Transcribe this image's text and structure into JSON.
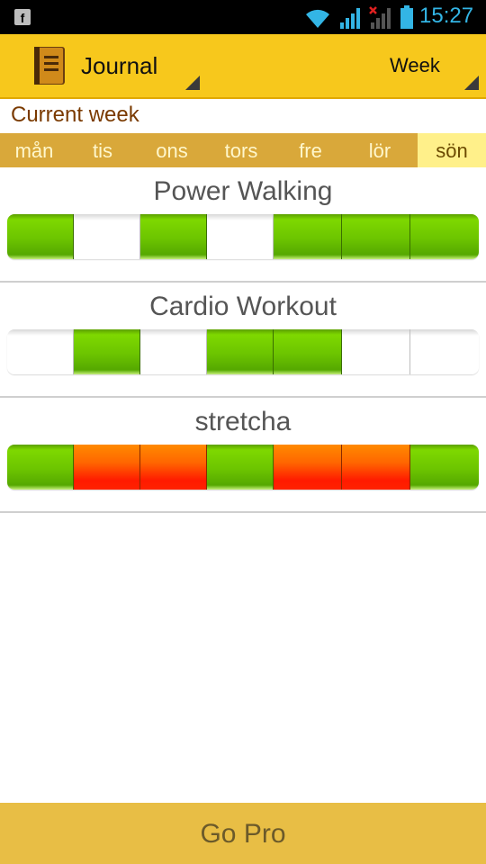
{
  "status_bar": {
    "time": "15:27",
    "notification_icon": "facebook-icon",
    "icons": [
      "wifi-icon",
      "signal-icon",
      "signal-no-sim-icon",
      "battery-icon"
    ],
    "accent_color": "#33b5e5"
  },
  "action_bar": {
    "title": "Journal",
    "period": "Week",
    "background_color": "#f7c81c"
  },
  "section_title": "Current week",
  "days": [
    {
      "label": "mån",
      "selected": false
    },
    {
      "label": "tis",
      "selected": false
    },
    {
      "label": "ons",
      "selected": false
    },
    {
      "label": "tors",
      "selected": false
    },
    {
      "label": "fre",
      "selected": false
    },
    {
      "label": "lör",
      "selected": false
    },
    {
      "label": "sön",
      "selected": true
    }
  ],
  "activities": [
    {
      "name": "Power Walking",
      "week": [
        "done",
        "empty",
        "done",
        "empty",
        "done",
        "done",
        "done"
      ]
    },
    {
      "name": "Cardio Workout",
      "week": [
        "empty",
        "done",
        "empty",
        "done",
        "done",
        "empty",
        "empty"
      ]
    },
    {
      "name": "stretcha",
      "week": [
        "done",
        "missed",
        "missed",
        "done",
        "missed",
        "missed",
        "done"
      ]
    }
  ],
  "status_colors": {
    "done": "#6cc400",
    "missed": "#ff3300"
  },
  "footer": {
    "button_label": "Go Pro"
  }
}
